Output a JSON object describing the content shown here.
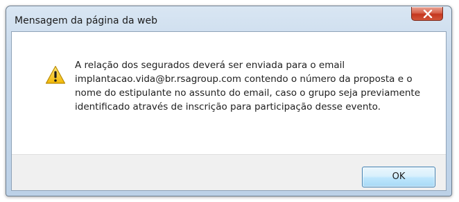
{
  "window": {
    "title": "Mensagem da página da web"
  },
  "dialog": {
    "icon": "warning-icon",
    "message": "A relação dos segurados deverá ser enviada para o email implantacao.vida@br.rsagroup.com contendo o número da proposta e o nome do estipulante no assunto do email, caso o grupo seja previamente identificado através de inscrição para participação desse evento."
  },
  "buttons": {
    "ok_label": "OK",
    "close_icon": "close-icon"
  },
  "colors": {
    "close_button": "#c94a33",
    "ok_button_border": "#3c7fb1",
    "warning_yellow": "#f5c400"
  }
}
